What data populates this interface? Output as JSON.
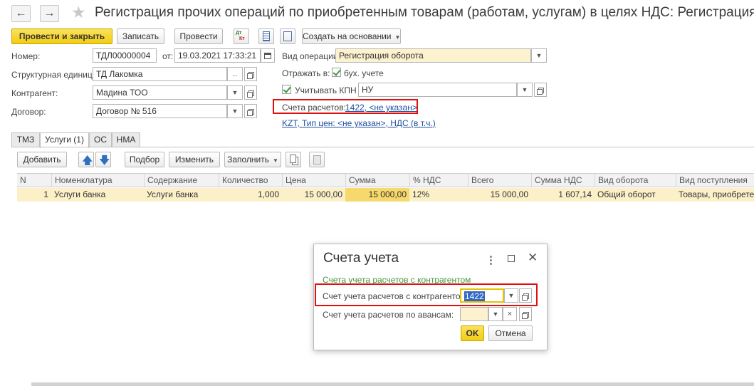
{
  "window": {
    "title": "Регистрация прочих операций по приобретенным товарам (работам, услугам) в целях НДС: Регистрация..."
  },
  "toolbar": {
    "post_close": "Провести и закрыть",
    "save": "Записать",
    "post": "Провести",
    "dtkt": "Дт Кт",
    "create_based": "Создать на основании"
  },
  "form": {
    "number_label": "Номер:",
    "number_value": "ТДЛ00000004",
    "date_label": "от:",
    "date_value": "19.03.2021 17:33:21",
    "unit_label": "Структурная единица:",
    "unit_value": "ТД Лакомка",
    "contractor_label": "Контрагент:",
    "contractor_value": "Мадина ТОО",
    "contract_label": "Договор:",
    "contract_value": "Договор № 516",
    "operation_label": "Вид операции:",
    "operation_value": "Регистрация оборота",
    "reflect_label": "Отражать в:",
    "reflect_check_label": "бух. учете",
    "kpn_label": "Учитывать КПН",
    "kpn_value": "НУ",
    "accounts_label": "Счета расчетов:",
    "accounts_link": "1422, <не указан>",
    "currency_link": "KZT, Тип цен: <не указан>, НДС (в т.ч.)"
  },
  "tabs": [
    "ТМЗ",
    "Услуги (1)",
    "ОС",
    "НМА"
  ],
  "table_toolbar": {
    "add": "Добавить",
    "select": "Подбор",
    "change": "Изменить",
    "fill": "Заполнить"
  },
  "table": {
    "columns": [
      "N",
      "Номенклатура",
      "Содержание",
      "Количество",
      "Цена",
      "Сумма",
      "% НДС",
      "Всего",
      "Сумма НДС",
      "Вид оборота",
      "Вид поступления"
    ],
    "rows": [
      [
        "1",
        "Услуги банка",
        "Услуги банка",
        "1,000",
        "15 000,00",
        "15 000,00",
        "12%",
        "15 000,00",
        "1 607,14",
        "Общий оборот",
        "Товары, приобретен"
      ]
    ]
  },
  "dialog": {
    "title": "Счета учета",
    "subtitle": "Счета учета расчетов с контрагентом",
    "field1_label": "Счет учета расчетов с контрагентом:",
    "field1_value": "1422",
    "field2_label": "Счет учета расчетов по авансам:",
    "field2_value": "",
    "ok": "OK",
    "cancel": "Отмена"
  },
  "colors": {
    "accent": "#f2cc14",
    "highlight_row": "#fbf0c8",
    "link": "#1f4f9e",
    "annotation": "#e01010"
  }
}
